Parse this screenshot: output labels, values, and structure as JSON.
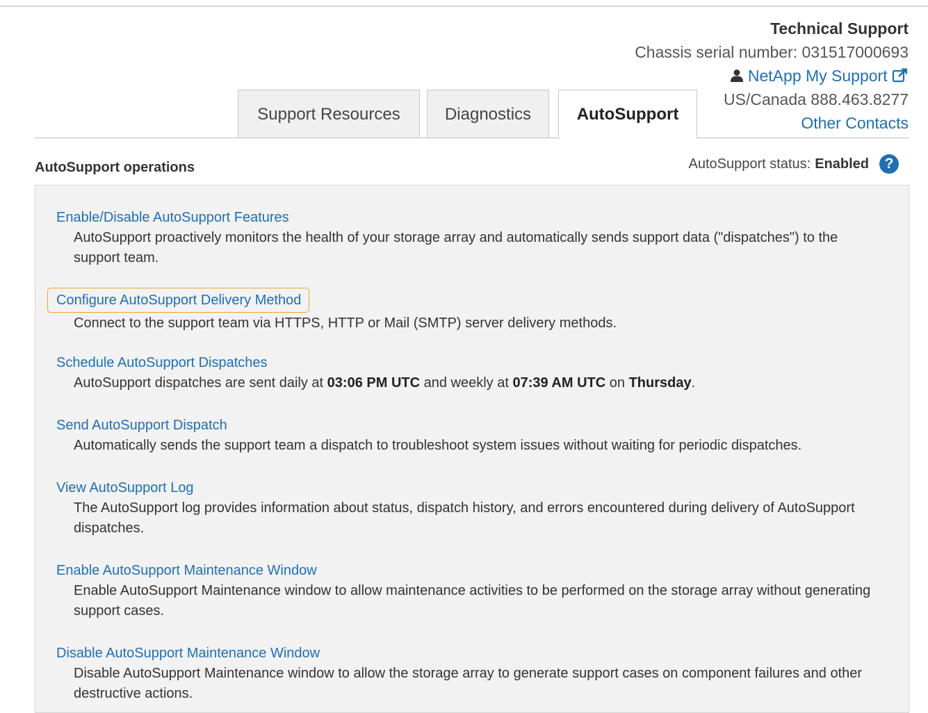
{
  "support": {
    "title": "Technical Support",
    "serial": "Chassis serial number: 031517000693",
    "my_support_label": "NetApp My Support",
    "phone": "US/Canada 888.463.8277",
    "other_contacts": "Other Contacts"
  },
  "tabs": [
    {
      "label": "Support Resources",
      "active": false
    },
    {
      "label": "Diagnostics",
      "active": false
    },
    {
      "label": "AutoSupport",
      "active": true
    }
  ],
  "section": {
    "title": "AutoSupport operations",
    "status_label": "AutoSupport status:",
    "status_value": "Enabled"
  },
  "operations": [
    {
      "link": "Enable/Disable AutoSupport Features",
      "desc": "AutoSupport proactively monitors the health of your storage array and automatically sends support data (\"dispatches\") to the support team."
    },
    {
      "link": "Configure AutoSupport Delivery Method",
      "desc": "Connect to the support team via HTTPS, HTTP or Mail (SMTP) server delivery methods.",
      "highlighted": true
    },
    {
      "link": "Schedule AutoSupport Dispatches",
      "desc_prefix": "AutoSupport dispatches are sent daily at ",
      "daily_time": "03:06 PM UTC",
      "desc_mid": " and weekly at ",
      "weekly_time": "07:39 AM UTC",
      "desc_on": " on ",
      "weekly_day": "Thursday",
      "desc_end": "."
    },
    {
      "link": "Send AutoSupport Dispatch",
      "desc": "Automatically sends the support team a dispatch to troubleshoot system issues without waiting for periodic dispatches."
    },
    {
      "link": "View AutoSupport Log",
      "desc": "The AutoSupport log provides information about status, dispatch history, and errors encountered during delivery of AutoSupport dispatches."
    },
    {
      "link": "Enable AutoSupport Maintenance Window",
      "desc": "Enable AutoSupport Maintenance window to allow maintenance activities to be performed on the storage array without generating support cases."
    },
    {
      "link": "Disable AutoSupport Maintenance Window",
      "desc": "Disable AutoSupport Maintenance window to allow the storage array to generate support cases on component failures and other destructive actions."
    }
  ],
  "colors": {
    "link": "#1f6fb5",
    "highlight": "#f0a030",
    "panel": "#f2f2f2"
  },
  "icons": {
    "user": "user-icon",
    "external": "external-link-icon",
    "help": "help-icon"
  }
}
